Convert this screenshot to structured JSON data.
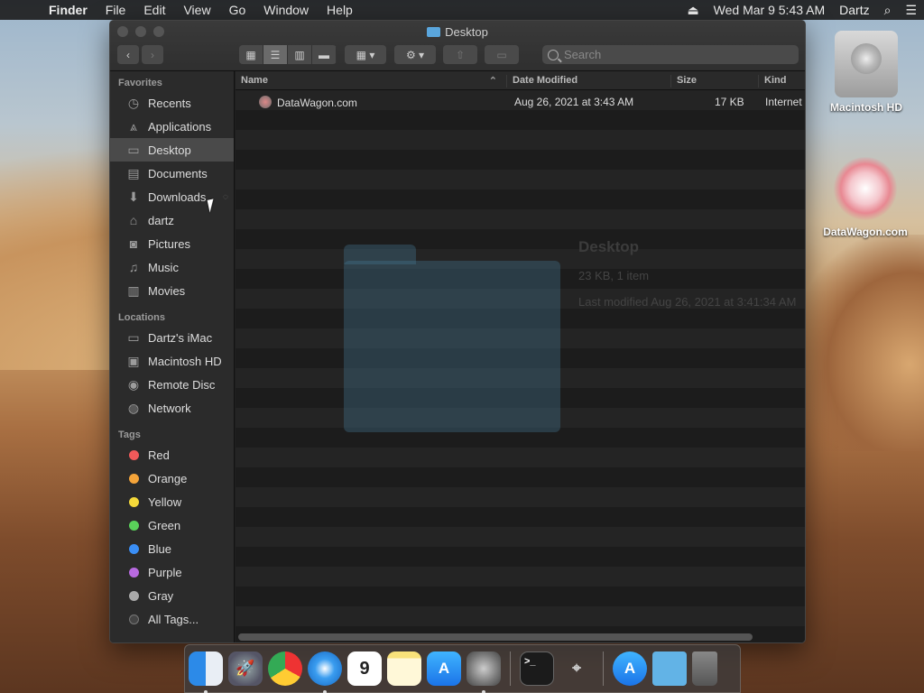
{
  "menubar": {
    "app": "Finder",
    "items": [
      "File",
      "Edit",
      "View",
      "Go",
      "Window",
      "Help"
    ],
    "datetime": "Wed Mar 9  5:43 AM",
    "user": "Dartz"
  },
  "window": {
    "title": "Desktop",
    "search_placeholder": "Search"
  },
  "sidebar": {
    "favorites_header": "Favorites",
    "favorites": [
      {
        "label": "Recents",
        "icon": "clock-icon"
      },
      {
        "label": "Applications",
        "icon": "applications-icon"
      },
      {
        "label": "Desktop",
        "icon": "desktop-icon",
        "selected": true
      },
      {
        "label": "Documents",
        "icon": "document-icon"
      },
      {
        "label": "Downloads",
        "icon": "download-icon"
      },
      {
        "label": "dartz",
        "icon": "home-icon"
      },
      {
        "label": "Pictures",
        "icon": "camera-icon"
      },
      {
        "label": "Music",
        "icon": "music-icon"
      },
      {
        "label": "Movies",
        "icon": "film-icon"
      }
    ],
    "locations_header": "Locations",
    "locations": [
      {
        "label": "Dartz's iMac",
        "icon": "imac-icon"
      },
      {
        "label": "Macintosh HD",
        "icon": "hard-drive-icon"
      },
      {
        "label": "Remote Disc",
        "icon": "disc-icon"
      },
      {
        "label": "Network",
        "icon": "globe-icon"
      }
    ],
    "tags_header": "Tags",
    "tags": [
      {
        "label": "Red",
        "color": "#f05a5a"
      },
      {
        "label": "Orange",
        "color": "#f4a43a"
      },
      {
        "label": "Yellow",
        "color": "#f5d93a"
      },
      {
        "label": "Green",
        "color": "#5ad25a"
      },
      {
        "label": "Blue",
        "color": "#3a8ef5"
      },
      {
        "label": "Purple",
        "color": "#b86ae0"
      },
      {
        "label": "Gray",
        "color": "#aaaaaa"
      }
    ],
    "all_tags": "All Tags..."
  },
  "columns": {
    "name": "Name",
    "date": "Date Modified",
    "size": "Size",
    "kind": "Kind"
  },
  "files": [
    {
      "name": "DataWagon.com",
      "date": "Aug 26, 2021 at 3:43 AM",
      "size": "17 KB",
      "kind": "Internet"
    }
  ],
  "info": {
    "title": "Desktop",
    "summary": "23 KB, 1 item",
    "modified": "Last modified Aug 26, 2021 at 3:41:34 AM"
  },
  "desktop_icons": [
    "Macintosh HD",
    "DataWagon.com"
  ]
}
